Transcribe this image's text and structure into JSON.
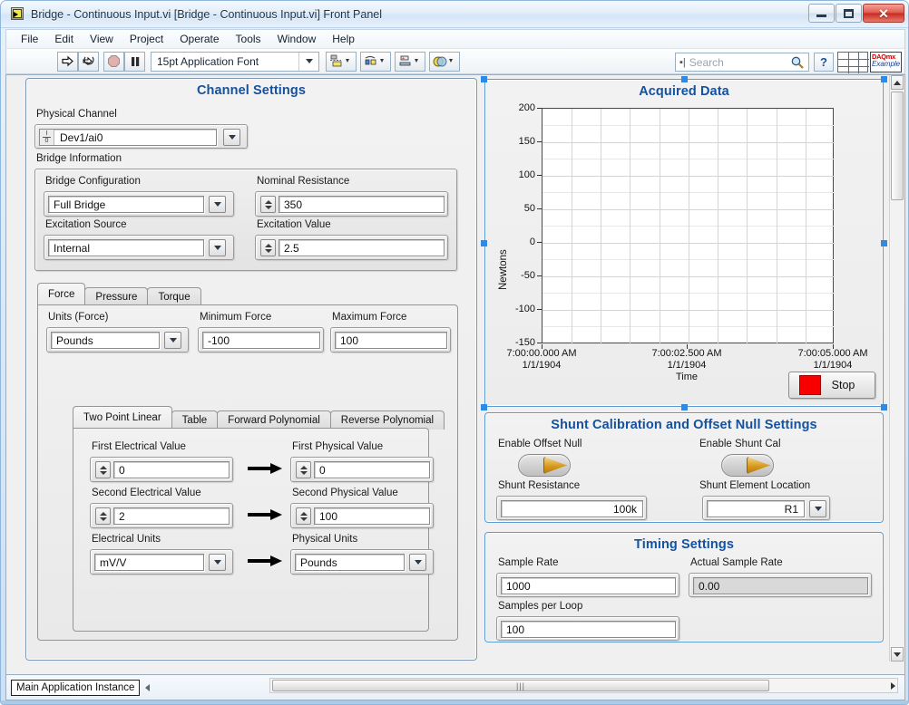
{
  "window": {
    "title": "Bridge - Continuous Input.vi [Bridge - Continuous Input.vi] Front Panel",
    "icon": "labview-vi-icon",
    "minimize": "minimize-icon",
    "maximize": "maximize-icon",
    "close": "✕"
  },
  "menu": {
    "items": [
      {
        "label": "File"
      },
      {
        "label": "Edit"
      },
      {
        "label": "View"
      },
      {
        "label": "Project"
      },
      {
        "label": "Operate"
      },
      {
        "label": "Tools"
      },
      {
        "label": "Window"
      },
      {
        "label": "Help"
      }
    ]
  },
  "toolbar": {
    "run_icon": "run-arrow-icon",
    "run_continuous_icon": "run-continuously-icon",
    "abort_icon": "abort-execution-icon",
    "pause_icon": "pause-icon",
    "font_selector": "15pt Application Font",
    "align_icon": "align-objects-icon",
    "distribute_icon": "distribute-objects-icon",
    "resize_icon": "resize-objects-icon",
    "reorder_icon": "reorder-objects-icon",
    "search_placeholder": "Search",
    "search_value": "",
    "search_icon": "magnifier-icon",
    "help_icon": "?",
    "grid_icon": "window-grid-icon",
    "daqmx_line1": "DAQmx",
    "daqmx_line2": "Example"
  },
  "channel_settings": {
    "title": "Channel Settings",
    "physical_channel": {
      "label": "Physical Channel",
      "value": "Dev1/ai0",
      "io_glyph": "I/O",
      "dropdown_icon": "chevron-down-icon"
    },
    "bridge_information": {
      "label": "Bridge Information",
      "bridge_configuration": {
        "label": "Bridge Configuration",
        "value": "Full Bridge"
      },
      "nominal_resistance": {
        "label": "Nominal Resistance",
        "value": "350"
      },
      "excitation_source": {
        "label": "Excitation Source",
        "value": "Internal"
      },
      "excitation_value": {
        "label": "Excitation Value",
        "value": "2.5"
      }
    },
    "measurement_tabs": {
      "tabs": [
        {
          "label": "Force",
          "active": true
        },
        {
          "label": "Pressure",
          "active": false
        },
        {
          "label": "Torque",
          "active": false
        }
      ],
      "units": {
        "label": "Units (Force)",
        "value": "Pounds"
      },
      "minimum": {
        "label": "Minimum Force",
        "value": "-100"
      },
      "maximum": {
        "label": "Maximum Force",
        "value": "100"
      }
    },
    "scaling_tabs": {
      "tabs": [
        {
          "label": "Two Point Linear",
          "active": true
        },
        {
          "label": "Table",
          "active": false
        },
        {
          "label": "Forward Polynomial",
          "active": false
        },
        {
          "label": "Reverse Polynomial",
          "active": false
        }
      ],
      "rows": [
        {
          "left_label": "First Electrical Value",
          "left_value": "0",
          "right_label": "First Physical Value",
          "right_value": "0",
          "type": "numeric"
        },
        {
          "left_label": "Second Electrical Value",
          "left_value": "2",
          "right_label": "Second Physical Value",
          "right_value": "100",
          "type": "numeric"
        },
        {
          "left_label": "Electrical Units",
          "left_value": "mV/V",
          "right_label": "Physical Units",
          "right_value": "Pounds",
          "type": "combo"
        }
      ],
      "arrow_icon": "right-arrow-icon"
    }
  },
  "acquired_data": {
    "title": "Acquired Data",
    "stop_button": "Stop",
    "stop_led_color": "#f90000"
  },
  "chart_data": {
    "type": "line",
    "title": "Acquired Data",
    "xlabel": "Time",
    "ylabel": "Newtons",
    "series": [
      {
        "name": "Acquired Data",
        "values": []
      }
    ],
    "ylim": [
      -150,
      200
    ],
    "yticks": [
      200,
      150,
      100,
      50,
      0,
      -50,
      -100,
      -150
    ],
    "ytick_labels": [
      "200",
      "150",
      "100",
      "50",
      "0",
      "-50",
      "-100",
      "-150"
    ],
    "xticks": [
      0,
      2.5,
      5
    ],
    "xtick_labels": [
      "7:00:00.000 AM\n1/1/1904",
      "7:00:02.500 AM\n1/1/1904",
      "7:00:05.000 AM\n1/1/1904"
    ],
    "xtick_lines": [
      [
        "7:00:00.000 AM",
        "1/1/1904"
      ],
      [
        "7:00:02.500 AM",
        "1/1/1904"
      ],
      [
        "7:00:05.000 AM",
        "1/1/1904"
      ]
    ],
    "grid": true,
    "legend": "none",
    "plot_background": "#ffffff",
    "grid_color": "#d4d4d4"
  },
  "shunt_settings": {
    "title": "Shunt Calibration and Offset Null Settings",
    "enable_offset_null": {
      "label": "Enable Offset Null",
      "state": "off"
    },
    "enable_shunt_cal": {
      "label": "Enable Shunt Cal",
      "state": "off"
    },
    "shunt_resistance": {
      "label": "Shunt Resistance",
      "value": "100k"
    },
    "shunt_element_location": {
      "label": "Shunt Element Location",
      "value": "R1"
    }
  },
  "timing_settings": {
    "title": "Timing Settings",
    "sample_rate": {
      "label": "Sample Rate",
      "value": "1000"
    },
    "actual_sample_rate": {
      "label": "Actual Sample Rate",
      "value": "0.00"
    },
    "samples_per_loop": {
      "label": "Samples per Loop",
      "value": "100"
    }
  },
  "statusbar": {
    "context": "Main Application Instance",
    "collapse_icon": "left-triangle-icon"
  },
  "colors": {
    "accent_blue": "#14519e",
    "panel_border": "#7e99b5",
    "selection": "#2e8ae6",
    "stop_red": "#f90000"
  }
}
